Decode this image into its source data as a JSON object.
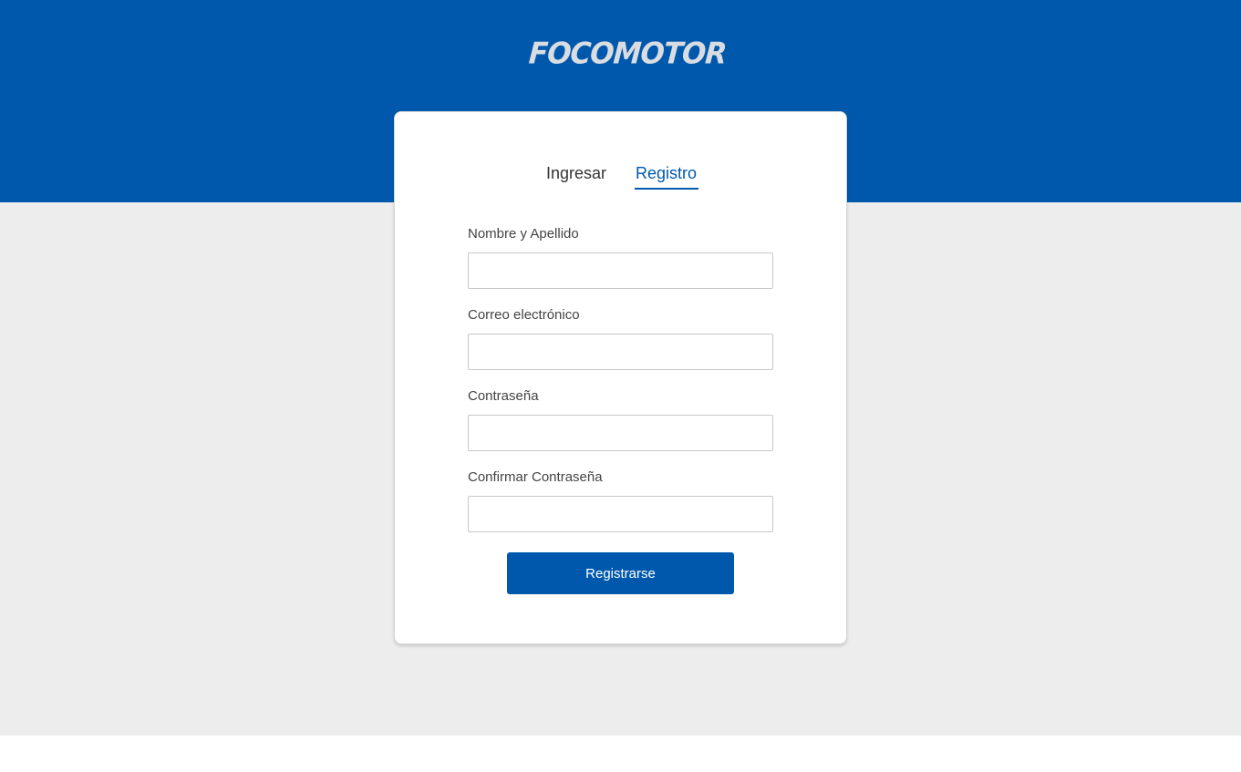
{
  "brand": {
    "logo_text": "FOCOMOTOR"
  },
  "colors": {
    "primary": "#0058ac",
    "background_gray": "#ededed",
    "card_background": "#ffffff"
  },
  "tabs": [
    {
      "label": "Ingresar",
      "active": false
    },
    {
      "label": "Registro",
      "active": true
    }
  ],
  "form": {
    "fields": [
      {
        "label": "Nombre y Apellido",
        "value": "",
        "placeholder": ""
      },
      {
        "label": "Correo electrónico",
        "value": "",
        "placeholder": ""
      },
      {
        "label": "Contraseña",
        "value": "",
        "placeholder": ""
      },
      {
        "label": "Confirmar Contraseña",
        "value": "",
        "placeholder": ""
      }
    ],
    "submit_label": "Registrarse"
  }
}
